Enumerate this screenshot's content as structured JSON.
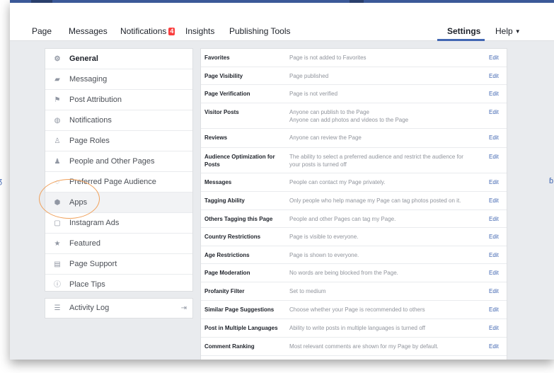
{
  "nav": {
    "page": "Page",
    "messages": "Messages",
    "notifications": "Notifications",
    "notifications_count": "4",
    "insights": "Insights",
    "publishing_tools": "Publishing Tools",
    "settings": "Settings",
    "help": "Help"
  },
  "sidebar": {
    "items": [
      {
        "label": "General",
        "icon": "gear-icon"
      },
      {
        "label": "Messaging",
        "icon": "chat-icon"
      },
      {
        "label": "Post Attribution",
        "icon": "flag-icon"
      },
      {
        "label": "Notifications",
        "icon": "globe-icon"
      },
      {
        "label": "Page Roles",
        "icon": "person-icon"
      },
      {
        "label": "People and Other Pages",
        "icon": "people-icon"
      },
      {
        "label": "Preferred Page Audience",
        "icon": "audience-icon"
      },
      {
        "label": "Apps",
        "icon": "apps-icon"
      },
      {
        "label": "Instagram Ads",
        "icon": "instagram-icon"
      },
      {
        "label": "Featured",
        "icon": "star-icon"
      },
      {
        "label": "Page Support",
        "icon": "support-icon"
      },
      {
        "label": "Place Tips",
        "icon": "info-icon"
      }
    ],
    "activity_log": "Activity Log"
  },
  "settings": {
    "edit_label": "Edit",
    "rows": [
      {
        "label": "Favorites",
        "value": [
          "Page is not added to Favorites"
        ]
      },
      {
        "label": "Page Visibility",
        "value": [
          "Page published"
        ]
      },
      {
        "label": "Page Verification",
        "value": [
          "Page is not verified"
        ]
      },
      {
        "label": "Visitor Posts",
        "value": [
          "Anyone can publish to the Page",
          "Anyone can add photos and videos to the Page"
        ]
      },
      {
        "label": "Reviews",
        "value": [
          "Anyone can review the Page"
        ]
      },
      {
        "label": "Audience Optimization for Posts",
        "value": [
          "The ability to select a preferred audience and restrict the audience for",
          "your posts is turned off"
        ]
      },
      {
        "label": "Messages",
        "value": [
          "People can contact my Page privately."
        ]
      },
      {
        "label": "Tagging Ability",
        "value": [
          "Only people who help manage my Page can tag photos posted on it."
        ]
      },
      {
        "label": "Others Tagging this Page",
        "value": [
          "People and other Pages can tag my Page."
        ]
      },
      {
        "label": "Country Restrictions",
        "value": [
          "Page is visible to everyone."
        ]
      },
      {
        "label": "Age Restrictions",
        "value": [
          "Page is shown to everyone."
        ]
      },
      {
        "label": "Page Moderation",
        "value": [
          "No words are being blocked from the Page."
        ]
      },
      {
        "label": "Profanity Filter",
        "value": [
          "Set to medium"
        ]
      },
      {
        "label": "Similar Page Suggestions",
        "value": [
          "Choose whether your Page is recommended to others"
        ]
      },
      {
        "label": "Post in Multiple Languages",
        "value": [
          "Ability to write posts in multiple languages is turned off"
        ]
      },
      {
        "label": "Comment Ranking",
        "value": [
          "Most relevant comments are shown for my Page by default."
        ]
      }
    ]
  },
  "colors": {
    "brand_blue": "#4267b2",
    "badge_red": "#fa3e3e",
    "highlight_orange": "#f0a05a"
  }
}
